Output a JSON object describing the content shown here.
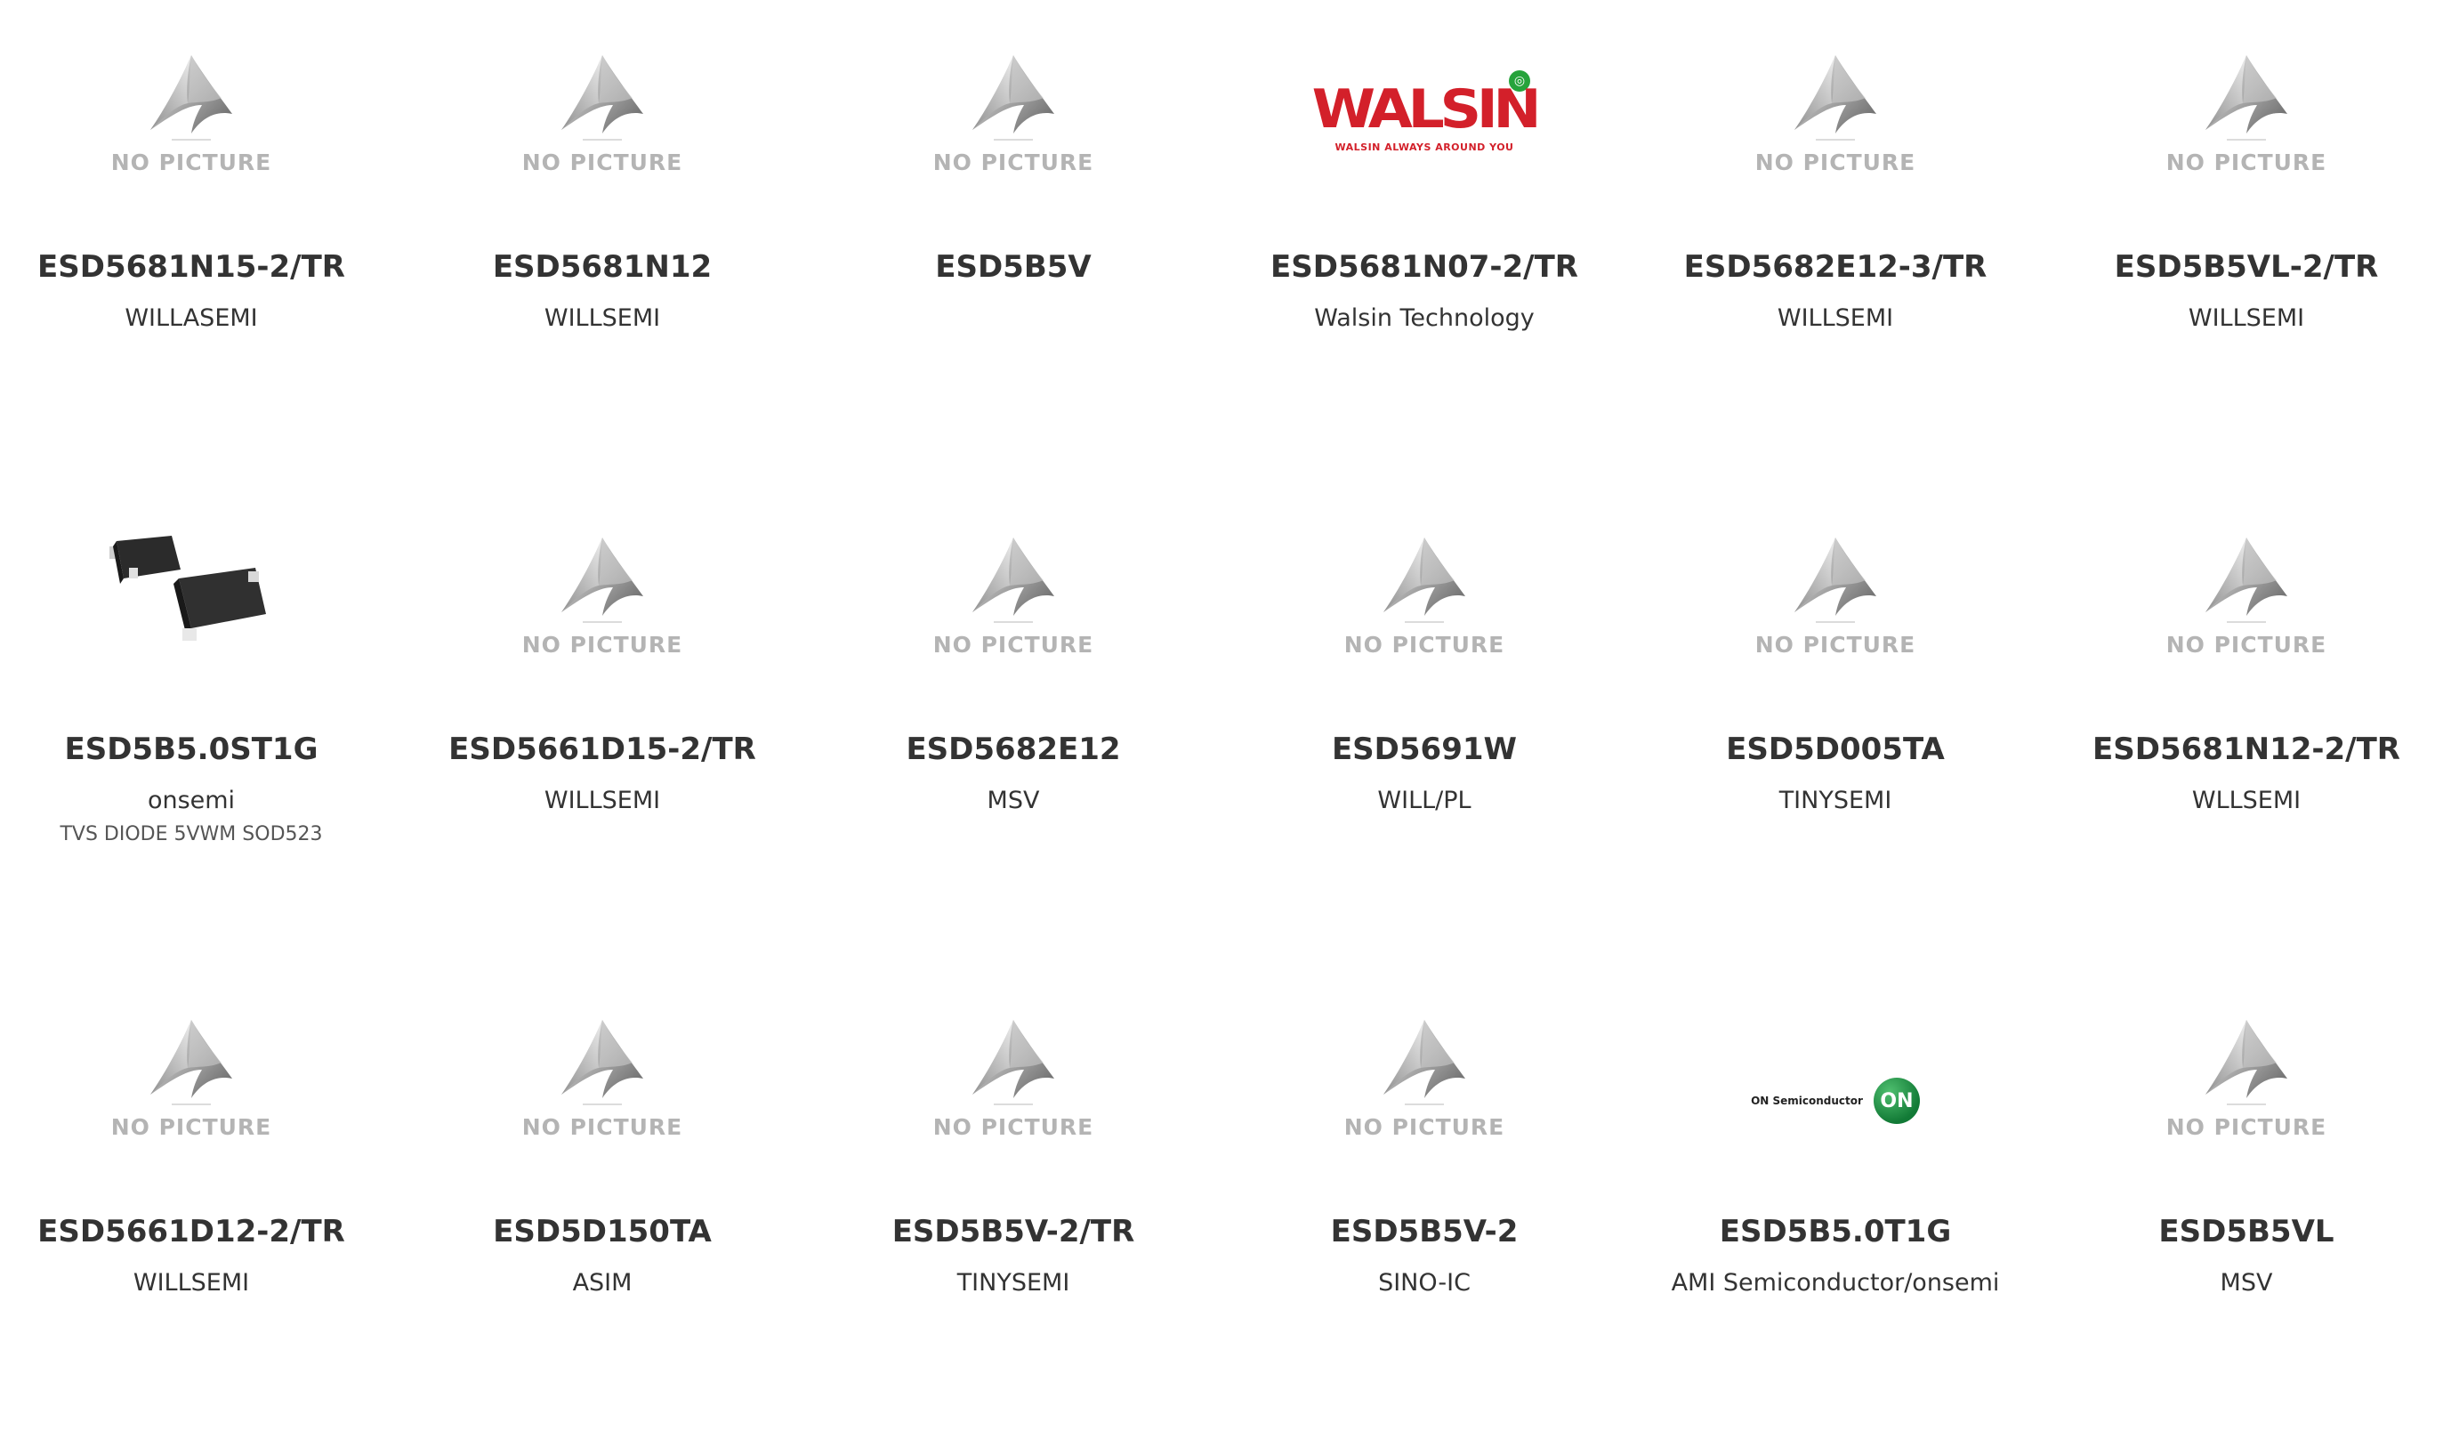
{
  "placeholder_text": "NO PICTURE",
  "walsin_logo": {
    "word": "WALSIN",
    "tagline": "WALSIN ALWAYS AROUND YOU"
  },
  "onsemi_logo": {
    "text": "ON Semiconductor",
    "badge": "ON"
  },
  "products": [
    {
      "part": "ESD5681N15-2/TR",
      "mfr": "WILLASEMI",
      "image": "no-picture"
    },
    {
      "part": "ESD5681N12",
      "mfr": "WILLSEMI",
      "image": "no-picture"
    },
    {
      "part": "ESD5B5V",
      "mfr": "",
      "image": "no-picture"
    },
    {
      "part": "ESD5681N07-2/TR",
      "mfr": "Walsin Technology",
      "image": "walsin-logo"
    },
    {
      "part": "ESD5682E12-3/TR",
      "mfr": "WILLSEMI",
      "image": "no-picture"
    },
    {
      "part": "ESD5B5VL-2/TR",
      "mfr": "WILLSEMI",
      "image": "no-picture"
    },
    {
      "part": "ESD5B5.0ST1G",
      "mfr": "onsemi",
      "desc": "TVS DIODE 5VWM SOD523",
      "image": "component-photo"
    },
    {
      "part": "ESD5661D15-2/TR",
      "mfr": "WILLSEMI",
      "image": "no-picture"
    },
    {
      "part": "ESD5682E12",
      "mfr": "MSV",
      "image": "no-picture"
    },
    {
      "part": "ESD5691W",
      "mfr": "WILL/PL",
      "image": "no-picture"
    },
    {
      "part": "ESD5D005TA",
      "mfr": "TINYSEMI",
      "image": "no-picture"
    },
    {
      "part": "ESD5681N12-2/TR",
      "mfr": "WLLSEMI",
      "image": "no-picture"
    },
    {
      "part": "ESD5661D12-2/TR",
      "mfr": "WILLSEMI",
      "image": "no-picture"
    },
    {
      "part": "ESD5D150TA",
      "mfr": "ASIM",
      "image": "no-picture"
    },
    {
      "part": "ESD5B5V-2/TR",
      "mfr": "TINYSEMI",
      "image": "no-picture"
    },
    {
      "part": "ESD5B5V-2",
      "mfr": "SINO-IC",
      "image": "no-picture"
    },
    {
      "part": "ESD5B5.0T1G",
      "mfr": "AMI Semiconductor/onsemi",
      "image": "onsemi-logo"
    },
    {
      "part": "ESD5B5VL",
      "mfr": "MSV",
      "image": "no-picture"
    }
  ]
}
